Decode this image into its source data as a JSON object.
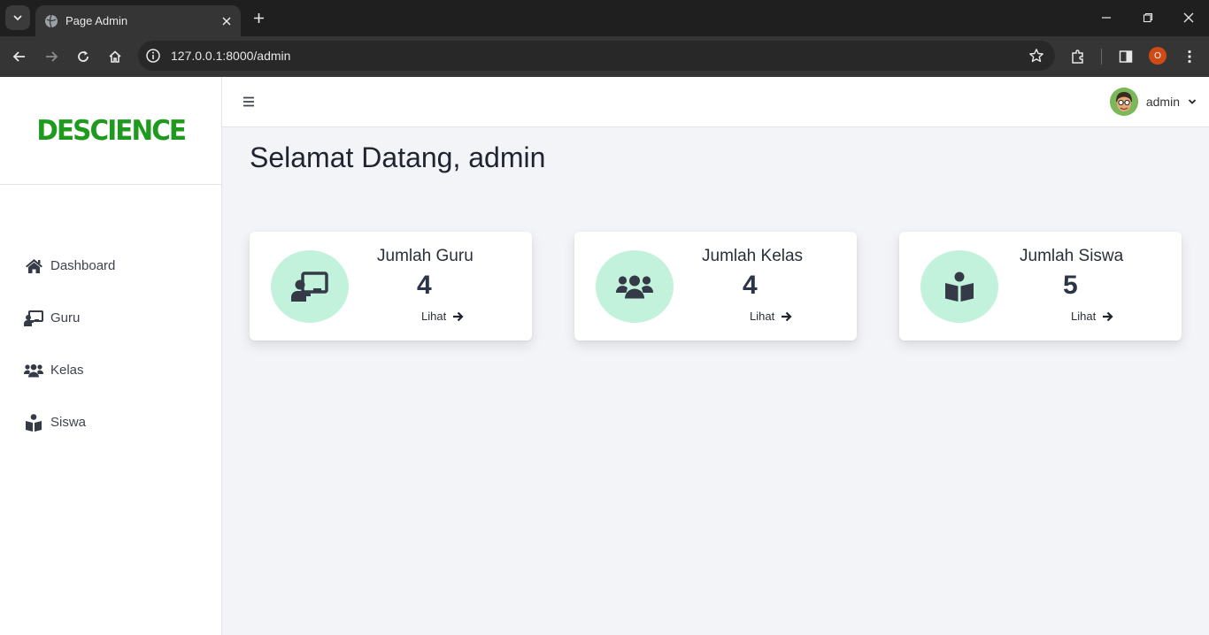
{
  "browser": {
    "tab_title": "Page Admin",
    "url": "127.0.0.1:8000/admin",
    "profile_badge": "O"
  },
  "app": {
    "logo_text": "DESCIENCE",
    "brand_color": "#1e9a1e",
    "accent_circle_color": "#c2f2dc"
  },
  "sidebar": {
    "items": [
      {
        "label": "Dashboard",
        "icon": "home-icon"
      },
      {
        "label": "Guru",
        "icon": "chalkboard-teacher-icon"
      },
      {
        "label": "Kelas",
        "icon": "users-icon"
      },
      {
        "label": "Siswa",
        "icon": "book-reader-icon"
      }
    ]
  },
  "topbar": {
    "user_name": "admin"
  },
  "main": {
    "welcome": "Selamat Datang, admin",
    "cards": [
      {
        "title": "Jumlah Guru",
        "value": "4",
        "link": "Lihat",
        "icon": "chalkboard-teacher-icon"
      },
      {
        "title": "Jumlah Kelas",
        "value": "4",
        "link": "Lihat",
        "icon": "users-icon"
      },
      {
        "title": "Jumlah Siswa",
        "value": "5",
        "link": "Lihat",
        "icon": "book-reader-icon"
      }
    ]
  }
}
